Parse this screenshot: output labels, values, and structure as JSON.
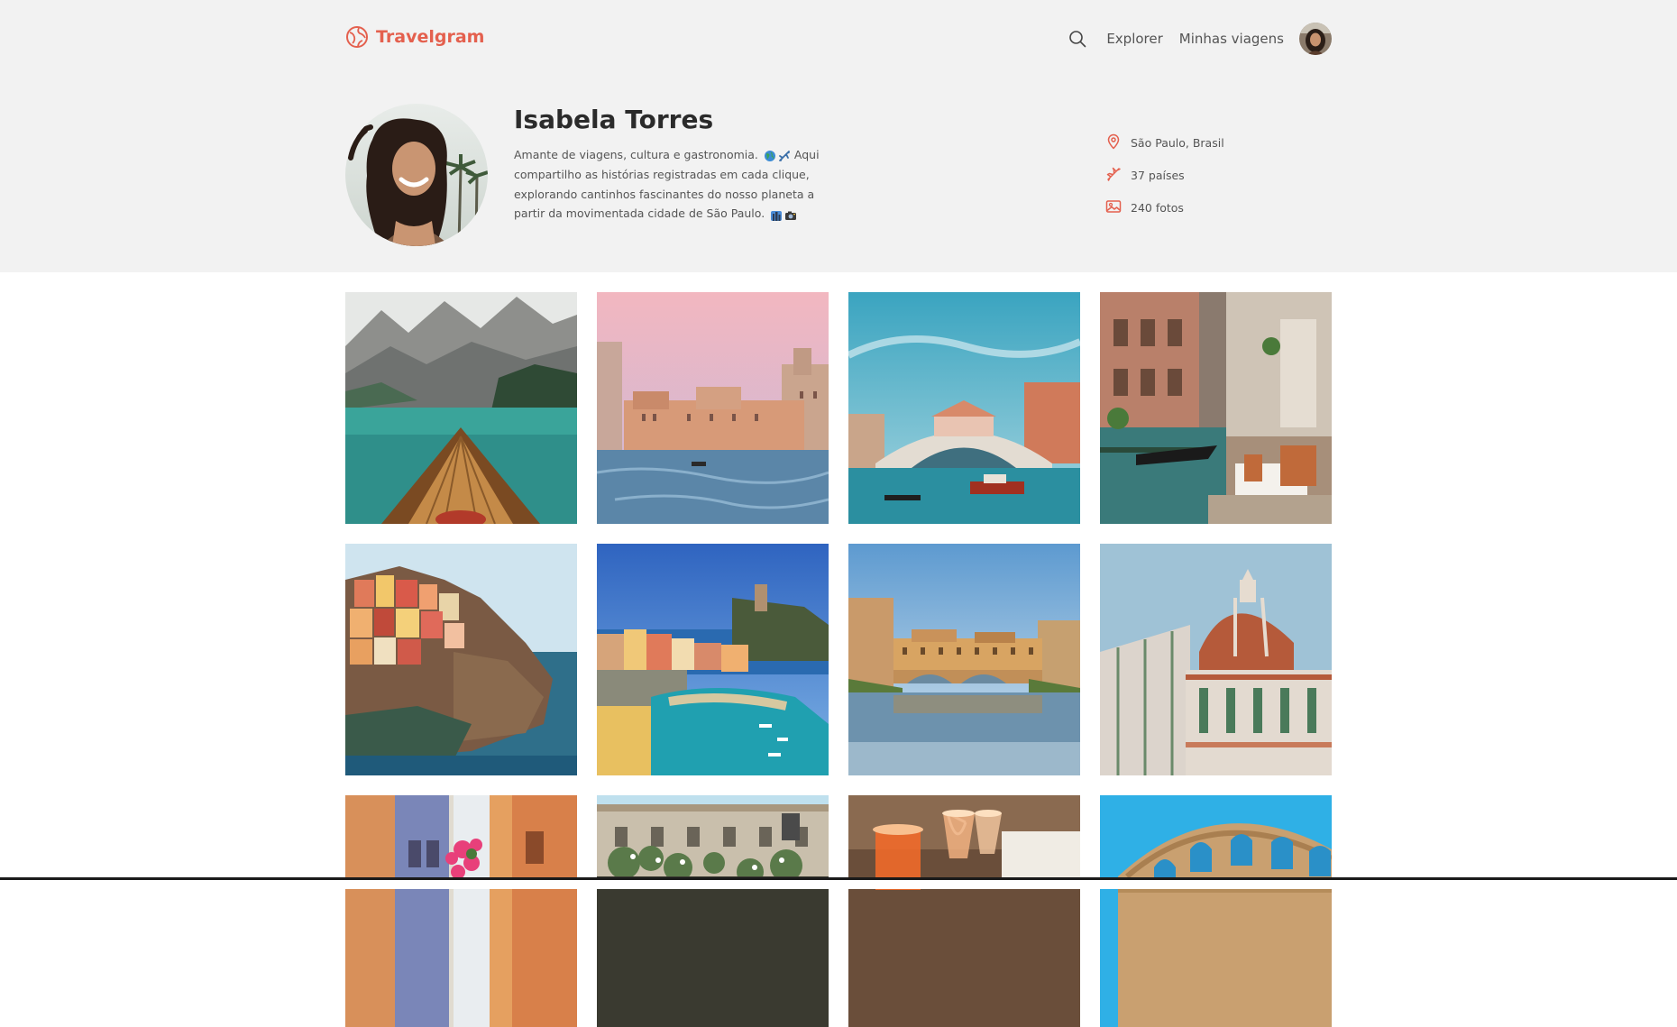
{
  "app": {
    "name": "Travelgram",
    "brand_color": "#e4604e"
  },
  "nav": {
    "search_icon": "search-icon",
    "links": [
      "Explorer",
      "Minhas viagens"
    ]
  },
  "profile": {
    "name": "Isabela Torres",
    "bio": "Amante de viagens, cultura e gastronomia. 🌍✈️ Aqui compartilho as histórias registradas em cada clique, explorando cantinhos fascinantes do nosso planeta a partir da movimentada cidade de São Paulo. 🏙️📸",
    "bio_text_line1": "Amante de viagens, cultura e gastronomia.",
    "bio_text_rest": "Aqui compartilho as histórias registradas em cada clique, explorando cantinhos fascinantes do nosso planeta a partir da movimentada cidade de São Paulo.",
    "stats": {
      "location": "São Paulo, Brasil",
      "countries": "37 países",
      "photos": "240 fotos"
    }
  },
  "gallery": {
    "photos": [
      {
        "subject": "boat-lake-mountains"
      },
      {
        "subject": "venice-canal-sunset"
      },
      {
        "subject": "rialto-bridge"
      },
      {
        "subject": "venice-restaurant-canal"
      },
      {
        "subject": "cinque-terre-manarola"
      },
      {
        "subject": "vernazza-harbor"
      },
      {
        "subject": "ponte-vecchio"
      },
      {
        "subject": "florence-duomo"
      },
      {
        "subject": "colorful-alley-flowers"
      },
      {
        "subject": "old-building-garden"
      },
      {
        "subject": "aperol-spritz-glasses"
      },
      {
        "subject": "colosseum"
      }
    ]
  }
}
